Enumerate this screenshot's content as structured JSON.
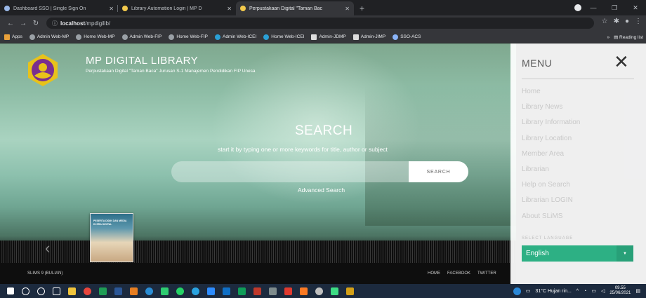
{
  "browser": {
    "tabs": [
      {
        "title": "Dashboard SSO | Single Sign On",
        "favicon_color": "#9ab8e8"
      },
      {
        "title": "Library Automation Login | MP D",
        "favicon_color": "#f2c94c"
      },
      {
        "title": "Perpustakaan Digital \"Taman Bac",
        "favicon_color": "#f2c94c",
        "active": true
      }
    ],
    "new_tab": "+",
    "url_scheme_icon": "ⓘ",
    "url_host": "localhost",
    "url_path": "/mpdigilib/",
    "bookmarks": [
      {
        "label": "Apps",
        "icon": "apps-icon"
      },
      {
        "label": "Admin Web-MP",
        "icon": "globe-icon"
      },
      {
        "label": "Home Web-MP",
        "icon": "globe-icon"
      },
      {
        "label": "Admin Web-FIP",
        "icon": "globe-icon"
      },
      {
        "label": "Home Web-FIP",
        "icon": "globe-icon"
      },
      {
        "label": "Admin Web-ICEI",
        "icon": "wordpress-icon"
      },
      {
        "label": "Home Web-ICEI",
        "icon": "wordpress-icon"
      },
      {
        "label": "Admin-JDMP",
        "icon": "pkp-icon"
      },
      {
        "label": "Admin-JIMP",
        "icon": "pkp-icon"
      },
      {
        "label": "SSO-ACS",
        "icon": "globe-icon"
      }
    ],
    "more_bookmarks": "»",
    "reading_list": "Reading list"
  },
  "site": {
    "title": "MP DIGITAL LIBRARY",
    "subtitle": "Perpustakaan Digital \"Taman Baca\" Jurusan S-1 Manajemen Pendidikan FIP Unesa",
    "search_heading": "SEARCH",
    "search_hint": "start it by typing one or more keywords for title, author or subject",
    "search_placeholder": "",
    "search_button": "SEARCH",
    "advanced_search": "Advanced Search",
    "book_cover_text": "PESERTA DIDIK DAN MEDIA DI ERA DIGITAL",
    "footer_version": "SLIMS 9 (BULIAN)",
    "footer_links": [
      "HOME",
      "FACEBOOK",
      "TWITTER"
    ]
  },
  "menu": {
    "title": "MENU",
    "items": [
      "Home",
      "Library News",
      "Library Information",
      "Library Location",
      "Member Area",
      "Librarian",
      "Help on Search",
      "Librarian LOGIN",
      "About SLiMS"
    ],
    "language_label": "SELECT LANGUAGE",
    "language_value": "English"
  },
  "taskbar": {
    "weather": "31°C  Hujan rin...",
    "time": "09.55",
    "date": "25/06/2021"
  },
  "colors": {
    "accent": "#2db084",
    "taskbar": "#1c2a3e"
  }
}
